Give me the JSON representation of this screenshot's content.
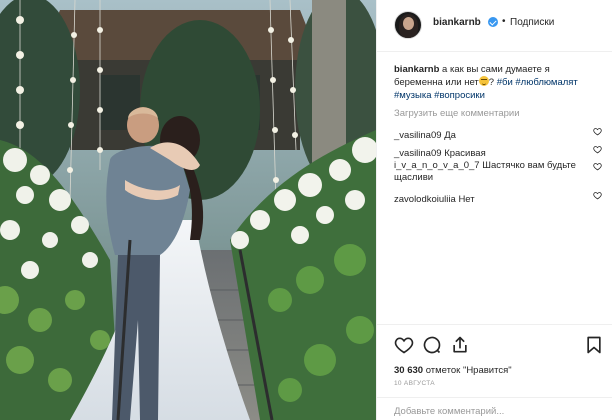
{
  "post": {
    "username": "biankarnb",
    "follow_label": "Подписки",
    "separator": "•",
    "caption_user": "biankarnb",
    "caption_text": "а как вы сами думаете я беременна или нет",
    "caption_after_emoji": "?",
    "hashtags": [
      "#би",
      "#люблюмалят",
      "#музыка",
      "#вопросики"
    ],
    "load_more": "Загрузить еще комментарии",
    "comments": [
      {
        "user": "_vasilina09",
        "text": "Да"
      },
      {
        "user": "_vasilina09",
        "text": "Красивая"
      },
      {
        "user": "i_v_a_n_o_v_a_0_7",
        "text": "Шастячко вам будьте щасливи"
      },
      {
        "user": "zavolodkoiuliia",
        "text": "Нет"
      }
    ],
    "likes_count": "30 630",
    "likes_label": "отметок \"Нравится\"",
    "date": "10 АВГУСТА",
    "add_comment_placeholder": "Добавьте комментарий..."
  },
  "icons": {
    "verified": "verified-badge-icon",
    "like": "heart-icon",
    "comment": "comment-bubble-icon",
    "share": "share-icon",
    "save": "bookmark-icon"
  },
  "colors": {
    "verified": "#3897f0",
    "hashtag": "#003569",
    "muted": "#999999",
    "text": "#262626"
  }
}
